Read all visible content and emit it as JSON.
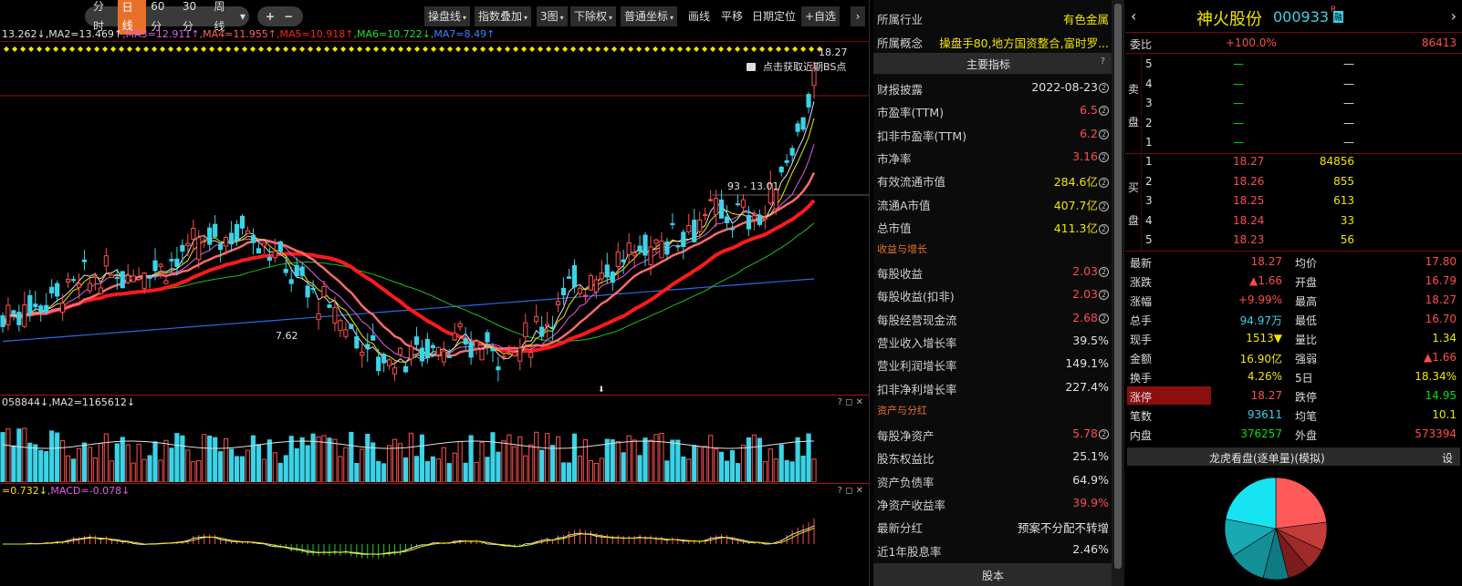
{
  "toolbar": {
    "periods": [
      "分时",
      "日线",
      "60分",
      "30分",
      "周线"
    ],
    "active_period": "日线",
    "zoom_in": "+",
    "zoom_out": "−",
    "buttons": [
      "操盘线",
      "指数叠加",
      "3图",
      "下除权",
      "普通坐标"
    ],
    "flat_buttons": [
      "画线",
      "平移",
      "日期定位"
    ],
    "watchlist": "+自选",
    "more": "›"
  },
  "chart": {
    "ma_header": [
      {
        "text": "13.262↓",
        "color": "#e0e0e0"
      },
      {
        "text": ",MA2=13.469↑",
        "color": "#e0e0e0"
      },
      {
        "text": ",MA3=12.911↑",
        "color": "#e060e0"
      },
      {
        "text": ",MA4=11.955↑",
        "color": "#ff6060"
      },
      {
        "text": ",MA5=10.918↑",
        "color": "#ff2020"
      },
      {
        "text": ",MA6=10.722↓",
        "color": "#20e020"
      },
      {
        "text": ",MA7=8.49↑",
        "color": "#4080ff"
      }
    ],
    "high_label": "18.27",
    "low_label": "7.62",
    "range_label": "93 - 13.01",
    "lock_hint": "点击获取近期BS点",
    "vol_header": "058844↓,MA2=1165612↓",
    "macd_header": [
      {
        "text": "=0.732↓",
        "color": "#f0e600"
      },
      {
        "text": ",MACD=-0.078↓",
        "color": "#e060e0"
      }
    ],
    "sub_ctrl": "? ◻ ✕"
  },
  "fin": {
    "industry_label": "所属行业",
    "industry_value": "有色金属",
    "concept_label": "所属概念",
    "concept_value": "操盘手80,地方国资整合,富时罗...",
    "main_title": "主要指标",
    "q": "?",
    "rows1": [
      {
        "label": "财报披露",
        "value": "2022-08-23",
        "color": "#e0e0e0"
      },
      {
        "label": "市盈率(TTM)",
        "value": "6.5",
        "color": "#ff4c4c"
      },
      {
        "label": "扣非市盈率(TTM)",
        "value": "6.2",
        "color": "#ff4c4c"
      },
      {
        "label": "市净率",
        "value": "3.16",
        "color": "#ff4c4c"
      },
      {
        "label": "有效流通市值",
        "value": "284.6亿",
        "color": "#f0e600"
      },
      {
        "label": "流通A市值",
        "value": "407.7亿",
        "color": "#f0e600"
      },
      {
        "label": "总市值",
        "value": "411.3亿",
        "color": "#f0e600"
      }
    ],
    "sect_growth": "收益与增长",
    "rows2": [
      {
        "label": "每股收益",
        "value": "2.03",
        "color": "#ff4c4c"
      },
      {
        "label": "每股收益(扣非)",
        "value": "2.03",
        "color": "#ff4c4c"
      },
      {
        "label": "每股经营现金流",
        "value": "2.68",
        "color": "#ff4c4c"
      },
      {
        "label": "营业收入增长率",
        "value": "39.5%",
        "color": "#e0e0e0"
      },
      {
        "label": "营业利润增长率",
        "value": "149.1%",
        "color": "#e0e0e0"
      },
      {
        "label": "扣非净利增长率",
        "value": "227.4%",
        "color": "#e0e0e0"
      }
    ],
    "sect_assets": "资产与分红",
    "rows3": [
      {
        "label": "每股净资产",
        "value": "5.78",
        "color": "#ff4c4c"
      },
      {
        "label": "股东权益比",
        "value": "25.1%",
        "color": "#e0e0e0"
      },
      {
        "label": "资产负债率",
        "value": "64.9%",
        "color": "#e0e0e0"
      },
      {
        "label": "净资产收益率",
        "value": "39.9%",
        "color": "#ff4c4c"
      },
      {
        "label": "最新分红",
        "value": "预案不分配不转增",
        "color": "#e0e0e0"
      },
      {
        "label": "近1年股息率",
        "value": "2.46%",
        "color": "#e0e0e0"
      }
    ],
    "bottom_tab": "股本"
  },
  "quote": {
    "name": "神火股份",
    "code": "000933",
    "badge_r": "R",
    "badge_rong": "融",
    "weibi_label": "委比",
    "weibi_value": "+100.0%",
    "weibi_vol": "86413",
    "sell_side": "卖盘",
    "buy_side": "买盘",
    "sell": [
      {
        "lvl": "5",
        "price": "—",
        "vol": "—"
      },
      {
        "lvl": "4",
        "price": "—",
        "vol": "—"
      },
      {
        "lvl": "3",
        "price": "—",
        "vol": "—"
      },
      {
        "lvl": "2",
        "price": "—",
        "vol": "—"
      },
      {
        "lvl": "1",
        "price": "—",
        "vol": "—"
      }
    ],
    "buy": [
      {
        "lvl": "1",
        "price": "18.27",
        "vol": "84856"
      },
      {
        "lvl": "2",
        "price": "18.26",
        "vol": "855"
      },
      {
        "lvl": "3",
        "price": "18.25",
        "vol": "613"
      },
      {
        "lvl": "4",
        "price": "18.24",
        "vol": "33"
      },
      {
        "lvl": "5",
        "price": "18.23",
        "vol": "56"
      }
    ],
    "stats": [
      {
        "l1": "最新",
        "v1": "18.27",
        "c1": "#ff4c4c",
        "l2": "均价",
        "v2": "17.80",
        "c2": "#ff4c4c"
      },
      {
        "l1": "涨跌",
        "v1": "▲1.66",
        "c1": "#ff4c4c",
        "l2": "开盘",
        "v2": "16.79",
        "c2": "#ff4c4c"
      },
      {
        "l1": "涨幅",
        "v1": "+9.99%",
        "c1": "#ff4c4c",
        "l2": "最高",
        "v2": "18.27",
        "c2": "#ff4c4c"
      },
      {
        "l1": "总手",
        "v1": "94.97万",
        "c1": "#3ad3e8",
        "l2": "最低",
        "v2": "16.70",
        "c2": "#ff4c4c"
      },
      {
        "l1": "现手",
        "v1": "1513▼",
        "c1": "#f0e600",
        "l2": "量比",
        "v2": "1.34",
        "c2": "#f0e600"
      },
      {
        "l1": "金额",
        "v1": "16.90亿",
        "c1": "#f0e600",
        "l2": "强弱",
        "v2": "▲1.66",
        "c2": "#ff4c4c"
      },
      {
        "l1": "换手",
        "v1": "4.26%",
        "c1": "#f0e600",
        "l2": "5日",
        "v2": "18.34%",
        "c2": "#f0e600"
      },
      {
        "l1": "涨停",
        "v1": "18.27",
        "c1": "#ff4c4c",
        "l2": "跌停",
        "v2": "14.95",
        "c2": "#00e400"
      },
      {
        "l1": "笔数",
        "v1": "93611",
        "c1": "#3ad3e8",
        "l2": "均笔",
        "v2": "10.1",
        "c2": "#f0e600"
      },
      {
        "l1": "内盘",
        "v1": "376257",
        "c1": "#00e400",
        "l2": "外盘",
        "v2": "573394",
        "c2": "#ff4c4c"
      }
    ],
    "dragon_title": "龙虎看盘(逐单量)(模拟)",
    "settings": "设",
    "pie": [
      {
        "label": "A",
        "share": 0.23,
        "color": "#ff5a5a"
      },
      {
        "label": "B",
        "share": 0.09,
        "color": "#c23c3c"
      },
      {
        "label": "C",
        "share": 0.07,
        "color": "#9e2a2a"
      },
      {
        "label": "D",
        "share": 0.07,
        "color": "#7c1c1c"
      },
      {
        "label": "E",
        "share": 0.08,
        "color": "#0e7a82"
      },
      {
        "label": "F",
        "share": 0.12,
        "color": "#138f98"
      },
      {
        "label": "G",
        "share": 0.12,
        "color": "#19a9b3"
      },
      {
        "label": "H",
        "share": 0.22,
        "color": "#17e4f2"
      }
    ]
  }
}
